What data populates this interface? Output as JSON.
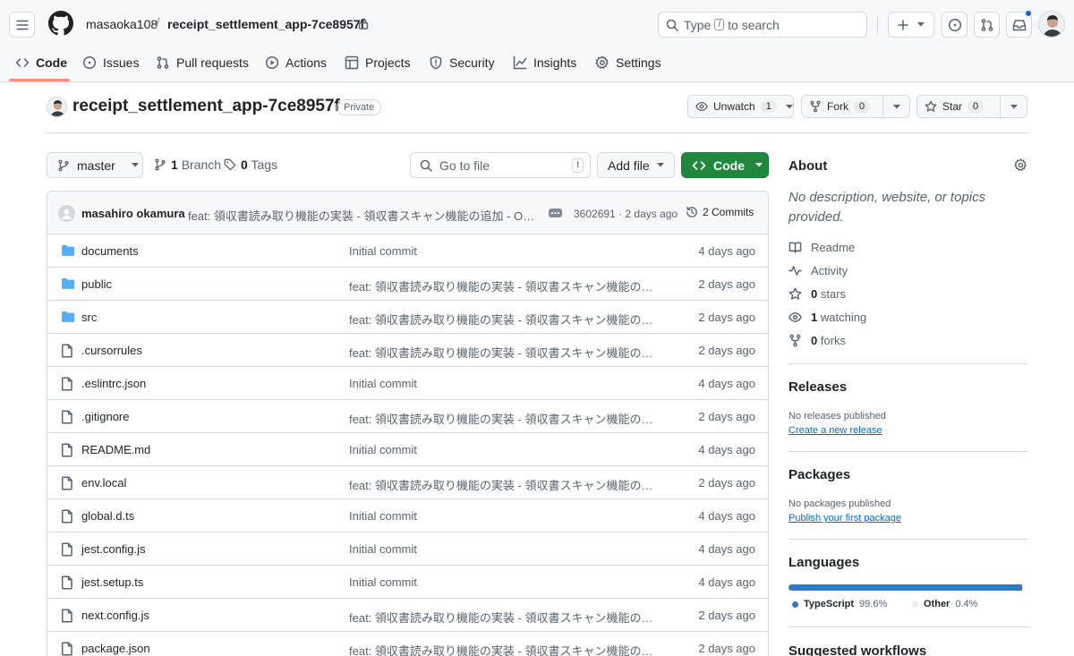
{
  "header": {
    "owner": "masaoka108",
    "separator": "/",
    "repo": "receipt_settlement_app-7ce8957f",
    "search_prefix": "Type",
    "search_key": "/",
    "search_suffix": "to search"
  },
  "tabs": [
    {
      "label": "Code",
      "icon": "code-icon"
    },
    {
      "label": "Issues",
      "icon": "issue-icon"
    },
    {
      "label": "Pull requests",
      "icon": "pull-request-icon"
    },
    {
      "label": "Actions",
      "icon": "play-icon"
    },
    {
      "label": "Projects",
      "icon": "table-icon"
    },
    {
      "label": "Security",
      "icon": "shield-icon"
    },
    {
      "label": "Insights",
      "icon": "graph-icon"
    },
    {
      "label": "Settings",
      "icon": "gear-icon"
    }
  ],
  "repo_header": {
    "title": "receipt_settlement_app-7ce8957f",
    "visibility": "Private",
    "unwatch_label": "Unwatch",
    "watch_count": "1",
    "fork_label": "Fork",
    "fork_count": "0",
    "star_label": "Star",
    "star_count": "0"
  },
  "toolbar": {
    "branch": "master",
    "branch_count": "1",
    "branch_label": "Branch",
    "tag_count": "0",
    "tag_label": "Tags",
    "goto_placeholder": "Go to file",
    "goto_key": "t",
    "add_file": "Add file",
    "code": "Code"
  },
  "latest_commit": {
    "author": "masahiro okamura",
    "message": "feat: 領収書読み取り機能の実装 - 領収書スキャン機能の追加 - OCR機能の統合",
    "hash_time": "3602691 · 2 days ago",
    "commits": "2 Commits"
  },
  "files": [
    {
      "type": "dir",
      "name": "documents",
      "message": "Initial commit",
      "date": "4 days ago"
    },
    {
      "type": "dir",
      "name": "public",
      "message": "feat: 領収書読み取り機能の実装 - 領収書スキャン機能の追加",
      "date": "2 days ago"
    },
    {
      "type": "dir",
      "name": "src",
      "message": "feat: 領収書読み取り機能の実装 - 領収書スキャン機能の追加",
      "date": "2 days ago"
    },
    {
      "type": "file",
      "name": ".cursorrules",
      "message": "feat: 領収書読み取り機能の実装 - 領収書スキャン機能の追加",
      "date": "2 days ago"
    },
    {
      "type": "file",
      "name": ".eslintrc.json",
      "message": "Initial commit",
      "date": "4 days ago"
    },
    {
      "type": "file",
      "name": ".gitignore",
      "message": "feat: 領収書読み取り機能の実装 - 領収書スキャン機能の追加",
      "date": "2 days ago"
    },
    {
      "type": "file",
      "name": "README.md",
      "message": "Initial commit",
      "date": "4 days ago"
    },
    {
      "type": "file",
      "name": "env.local",
      "message": "feat: 領収書読み取り機能の実装 - 領収書スキャン機能の追加",
      "date": "2 days ago"
    },
    {
      "type": "file",
      "name": "global.d.ts",
      "message": "Initial commit",
      "date": "4 days ago"
    },
    {
      "type": "file",
      "name": "jest.config.js",
      "message": "Initial commit",
      "date": "4 days ago"
    },
    {
      "type": "file",
      "name": "jest.setup.ts",
      "message": "Initial commit",
      "date": "4 days ago"
    },
    {
      "type": "file",
      "name": "next.config.js",
      "message": "feat: 領収書読み取り機能の実装 - 領収書スキャン機能の追加",
      "date": "2 days ago"
    },
    {
      "type": "file",
      "name": "package.json",
      "message": "feat: 領収書読み取り機能の実装 - 領収書スキャン機能の追加",
      "date": "2 days ago"
    }
  ],
  "sidebar": {
    "about_title": "About",
    "about_desc": "No description, website, or topics provided.",
    "readme": "Readme",
    "activity": "Activity",
    "stars_count": "0",
    "stars_label": "stars",
    "watching_count": "1",
    "watching_label": "watching",
    "forks_count": "0",
    "forks_label": "forks",
    "releases_title": "Releases",
    "releases_none": "No releases published",
    "releases_link": "Create a new release",
    "packages_title": "Packages",
    "packages_none": "No packages published",
    "packages_link": "Publish your first package",
    "languages_title": "Languages",
    "languages": [
      {
        "name": "TypeScript",
        "percent": "99.6%",
        "value": 99.6,
        "color": "#3178c6"
      },
      {
        "name": "Other",
        "percent": "0.4%",
        "value": 0.4,
        "color": "#ededed"
      }
    ],
    "workflows_title": "Suggested workflows"
  }
}
